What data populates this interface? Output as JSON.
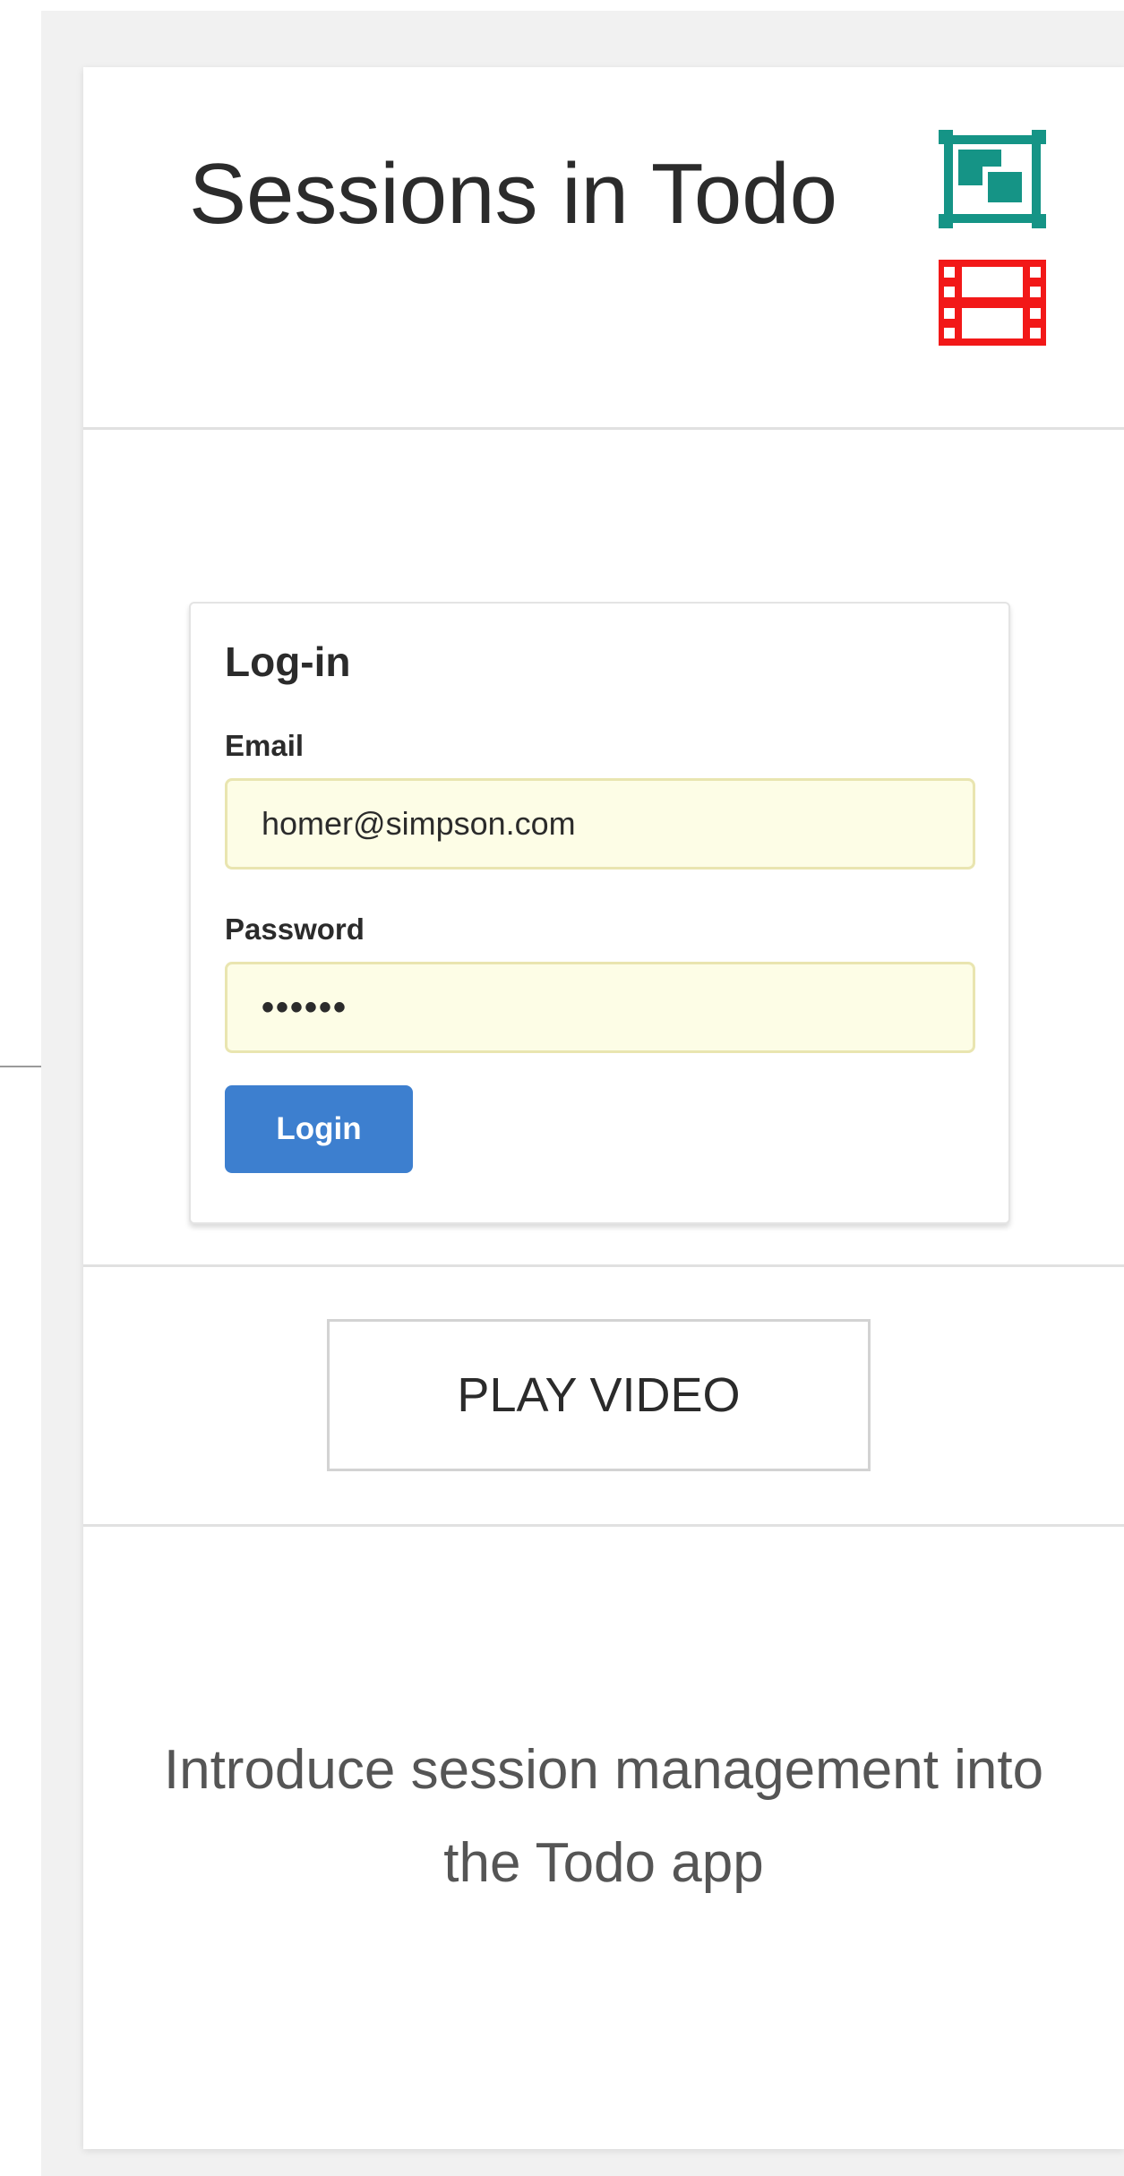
{
  "card": {
    "title": "Sessions in Todo",
    "description": "Introduce session management into the Todo app",
    "icons": {
      "slides": {
        "name": "slides-icon",
        "color": "#159486"
      },
      "video": {
        "name": "film-icon",
        "color": "#f21818"
      }
    }
  },
  "preview": {
    "heading": "Log-in",
    "email_label": "Email",
    "email_value": "homer@simpson.com",
    "password_label": "Password",
    "password_value": "••••••",
    "login_button": "Login",
    "button_color": "#3d7fcf",
    "input_bg": "#fdfde6"
  },
  "actions": {
    "play_video": "PLAY VIDEO"
  }
}
